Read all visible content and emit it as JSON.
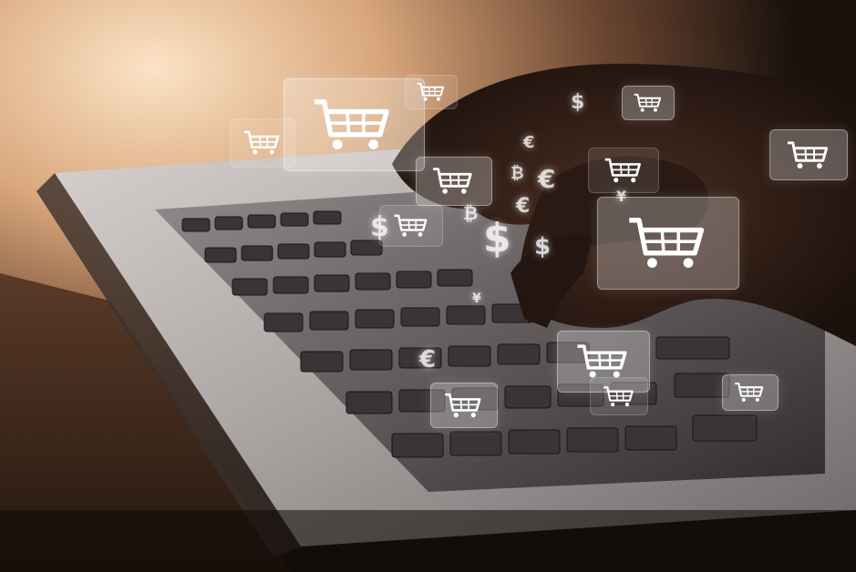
{
  "image": {
    "colors": {
      "warm_glow": "#f2c9a0",
      "laptop_body": "#9a9596",
      "keyboard_dark": "#2a2426",
      "hands": "#2b1a14",
      "background_dark": "#1a120d",
      "tile_overlay": "#ffffff"
    },
    "icons": [
      "shopping-cart-icon",
      "dollar-sign-icon",
      "euro-sign-icon",
      "bitcoin-sign-icon",
      "yen-sign-icon"
    ],
    "currency_glyphs": [
      "$",
      "€",
      "₿",
      "¥",
      "$",
      "€",
      "₿",
      "$",
      "€",
      "¥",
      "$",
      "€"
    ]
  }
}
